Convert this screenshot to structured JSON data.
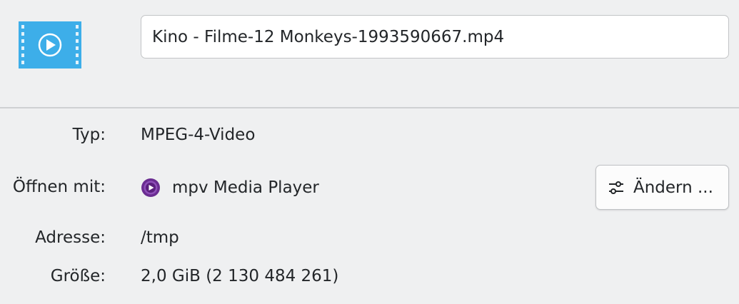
{
  "file": {
    "icon": "video-file-icon",
    "name": "Kino - Filme-12 Monkeys-1993590667.mp4"
  },
  "properties": {
    "type_label": "Typ:",
    "type_value": "MPEG-4-Video",
    "open_with_label": "Öffnen mit:",
    "open_with_app": "mpv Media Player",
    "open_with_icon": "mpv-icon",
    "change_button_label": "Ändern ...",
    "change_button_icon": "configure-icon",
    "address_label": "Adresse:",
    "address_value": "/tmp",
    "size_label": "Größe:",
    "size_value": "2,0 GiB (2 130 484 261)"
  },
  "colors": {
    "icon_blue": "#3daee9",
    "mpv_purple": "#6a2c91",
    "background": "#eff0f1"
  }
}
